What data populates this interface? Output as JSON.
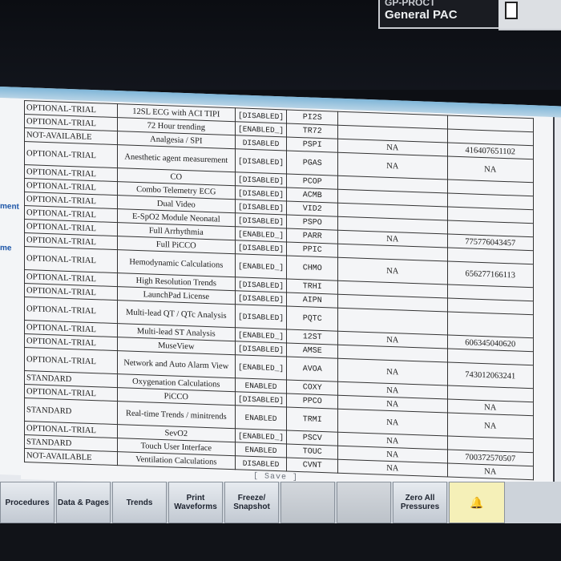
{
  "header": {
    "line1": "GP-PROCT",
    "line2": "General PAC"
  },
  "left_panel": {
    "label_1": "ment",
    "label_2": "me"
  },
  "table": {
    "rows": [
      {
        "status": "OPTIONAL-TRIAL",
        "feature": "12SL ECG with ACI TIPI",
        "state": "[DISABLED]",
        "code": "PI2S",
        "na": "",
        "key": "",
        "tall": false
      },
      {
        "status": "OPTIONAL-TRIAL",
        "feature": "72 Hour trending",
        "state": "[ENABLED_]",
        "code": "TR72",
        "na": "",
        "key": "",
        "tall": false
      },
      {
        "status": "NOT-AVAILABLE",
        "feature": "Analgesia / SPI",
        "state": "DISABLED",
        "code": "PSPI",
        "na": "NA",
        "key": "416407651102",
        "tall": false
      },
      {
        "status": "OPTIONAL-TRIAL",
        "feature": "Anesthetic agent measurement",
        "state": "[DISABLED]",
        "code": "PGAS",
        "na": "NA",
        "key": "NA",
        "tall": true
      },
      {
        "status": "OPTIONAL-TRIAL",
        "feature": "CO",
        "state": "[DISABLED]",
        "code": "PCOP",
        "na": "",
        "key": "",
        "tall": false
      },
      {
        "status": "OPTIONAL-TRIAL",
        "feature": "Combo Telemetry ECG",
        "state": "[DISABLED]",
        "code": "ACMB",
        "na": "",
        "key": "",
        "tall": false
      },
      {
        "status": "OPTIONAL-TRIAL",
        "feature": "Dual Video",
        "state": "[DISABLED]",
        "code": "VID2",
        "na": "",
        "key": "",
        "tall": false
      },
      {
        "status": "OPTIONAL-TRIAL",
        "feature": "E-SpO2 Module Neonatal",
        "state": "[DISABLED]",
        "code": "PSPO",
        "na": "",
        "key": "",
        "tall": false
      },
      {
        "status": "OPTIONAL-TRIAL",
        "feature": "Full Arrhythmia",
        "state": "[ENABLED_]",
        "code": "PARR",
        "na": "NA",
        "key": "775776043457",
        "tall": false
      },
      {
        "status": "OPTIONAL-TRIAL",
        "feature": "Full PiCCO",
        "state": "[DISABLED]",
        "code": "PPIC",
        "na": "",
        "key": "",
        "tall": false
      },
      {
        "status": "OPTIONAL-TRIAL",
        "feature": "Hemodynamic Calculations",
        "state": "[ENABLED_]",
        "code": "CHMO",
        "na": "NA",
        "key": "656277166113",
        "tall": true
      },
      {
        "status": "OPTIONAL-TRIAL",
        "feature": "High Resolution Trends",
        "state": "[DISABLED]",
        "code": "TRHI",
        "na": "",
        "key": "",
        "tall": false
      },
      {
        "status": "OPTIONAL-TRIAL",
        "feature": "LaunchPad License",
        "state": "[DISABLED]",
        "code": "AIPN",
        "na": "",
        "key": "",
        "tall": false
      },
      {
        "status": "OPTIONAL-TRIAL",
        "feature": "Multi-lead QT / QTc Analysis",
        "state": "[DISABLED]",
        "code": "PQTC",
        "na": "",
        "key": "",
        "tall": true
      },
      {
        "status": "OPTIONAL-TRIAL",
        "feature": "Multi-lead ST Analysis",
        "state": "[ENABLED_]",
        "code": "12ST",
        "na": "NA",
        "key": "606345040620",
        "tall": false
      },
      {
        "status": "OPTIONAL-TRIAL",
        "feature": "MuseView",
        "state": "[DISABLED]",
        "code": "AMSE",
        "na": "",
        "key": "",
        "tall": false
      },
      {
        "status": "OPTIONAL-TRIAL",
        "feature": "Network and Auto Alarm View",
        "state": "[ENABLED_]",
        "code": "AVOA",
        "na": "NA",
        "key": "743012063241",
        "tall": true
      },
      {
        "status": "STANDARD",
        "feature": "Oxygenation Calculations",
        "state": "ENABLED",
        "code": "COXY",
        "na": "NA",
        "key": "",
        "tall": false
      },
      {
        "status": "OPTIONAL-TRIAL",
        "feature": "PiCCO",
        "state": "[DISABLED]",
        "code": "PPCO",
        "na": "NA",
        "key": "NA",
        "tall": false
      },
      {
        "status": "STANDARD",
        "feature": "Real-time Trends / minitrends",
        "state": "ENABLED",
        "code": "TRMI",
        "na": "NA",
        "key": "NA",
        "tall": true
      },
      {
        "status": "OPTIONAL-TRIAL",
        "feature": "SevO2",
        "state": "[ENABLED_]",
        "code": "PSCV",
        "na": "NA",
        "key": "",
        "tall": false
      },
      {
        "status": "STANDARD",
        "feature": "Touch User Interface",
        "state": "ENABLED",
        "code": "TOUC",
        "na": "NA",
        "key": "700372570507",
        "tall": false
      },
      {
        "status": "NOT-AVAILABLE",
        "feature": "Ventilation Calculations",
        "state": "DISABLED",
        "code": "CVNT",
        "na": "NA",
        "key": "NA",
        "tall": false
      }
    ]
  },
  "dialog": {
    "save_label": "[ Save ]",
    "close_glyph": "✕"
  },
  "toolbar": {
    "buttons": [
      {
        "label": "Procedures",
        "enabled": true
      },
      {
        "label": "Data & Pages",
        "enabled": true
      },
      {
        "label": "Trends",
        "enabled": true
      },
      {
        "label": "Print Waveforms",
        "enabled": true
      },
      {
        "label": "Freeze/ Snapshot",
        "enabled": true
      },
      {
        "label": "",
        "enabled": false
      },
      {
        "label": "",
        "enabled": false
      },
      {
        "label": "Zero All Pressures",
        "enabled": true
      }
    ],
    "alarm_icon": "alarm-bell-icon"
  }
}
